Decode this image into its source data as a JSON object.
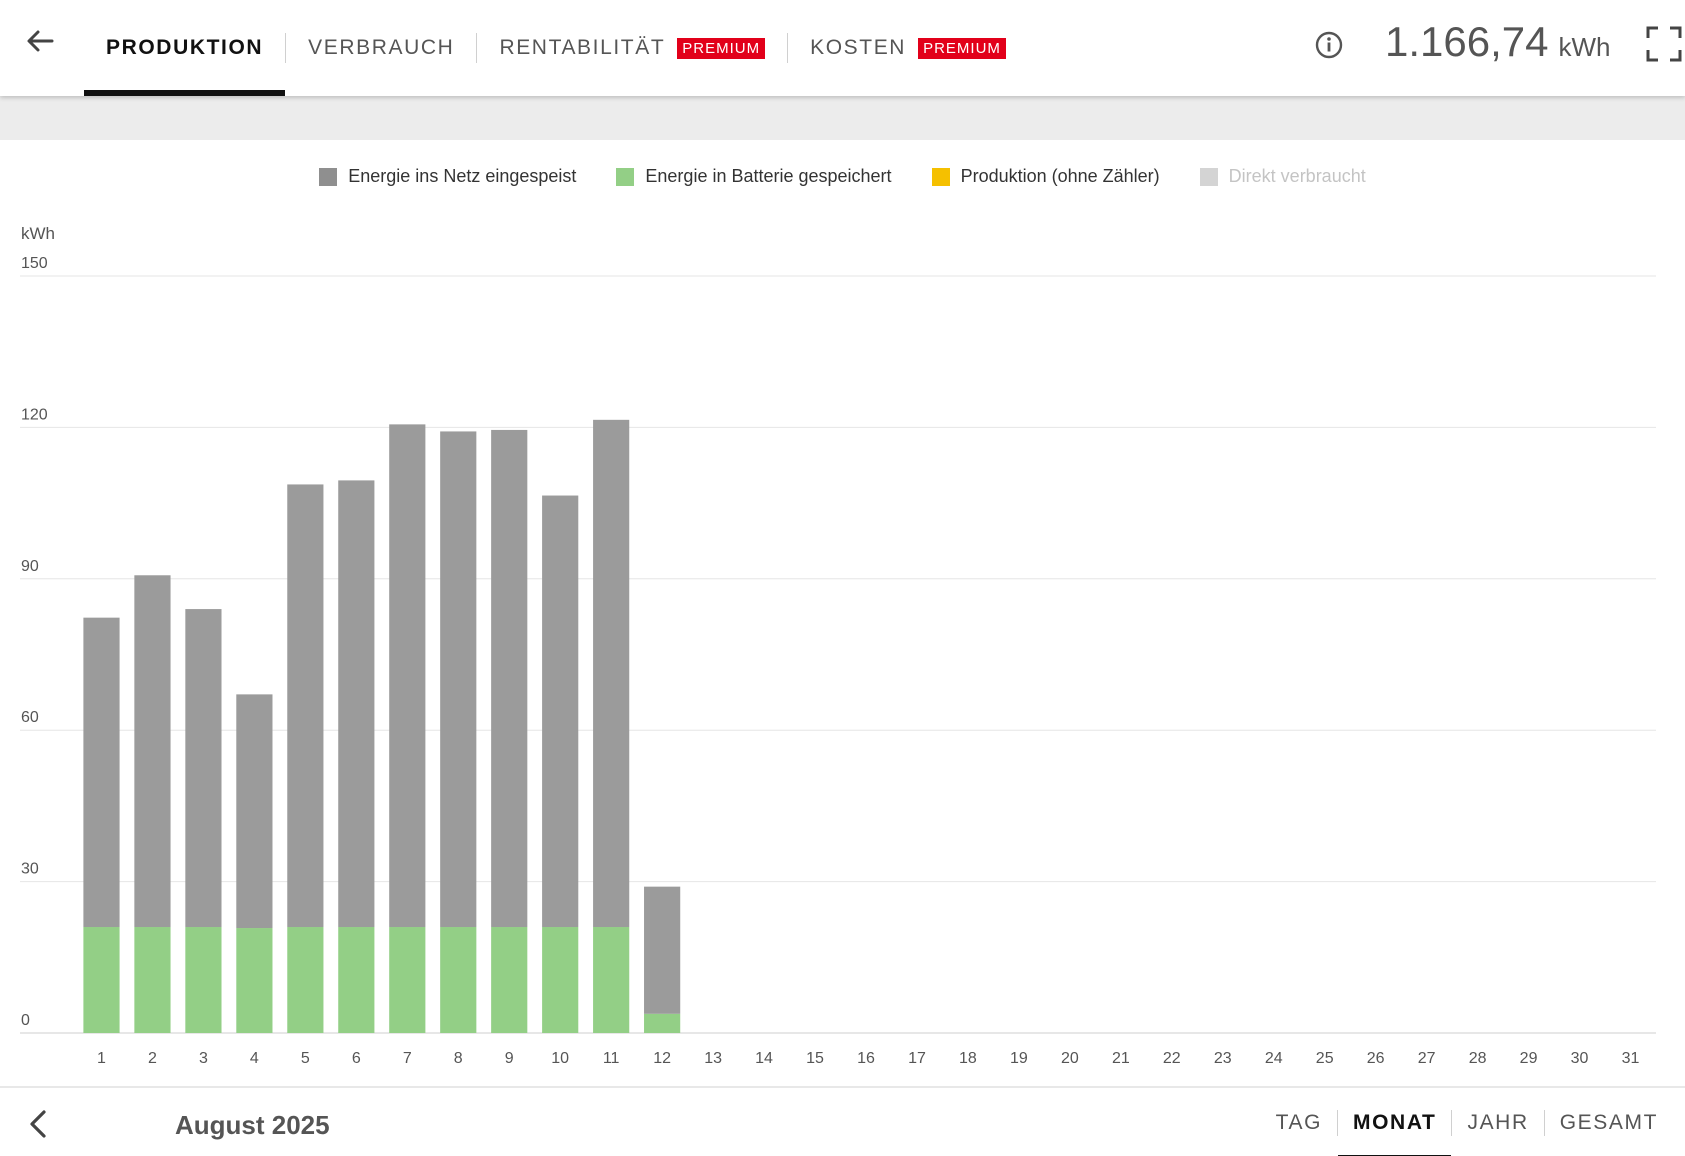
{
  "header": {
    "tabs": [
      {
        "label": "PRODUKTION",
        "active": true,
        "badge": ""
      },
      {
        "label": "VERBRAUCH",
        "active": false,
        "badge": ""
      },
      {
        "label": "RENTABILITÄT",
        "active": false,
        "badge": "PREMIUM"
      },
      {
        "label": "KOSTEN",
        "active": false,
        "badge": "PREMIUM"
      }
    ],
    "total_value": "1.166,74",
    "total_unit": "kWh"
  },
  "colors": {
    "grid_feed": "#9b9b9b",
    "battery": "#93cf86",
    "production_no_meter": "#f5c000",
    "direct_consumed": "#cccccc",
    "badge": "#e2001a"
  },
  "legend": [
    {
      "label": "Energie ins Netz eingespeist",
      "color": "#8f8f8f",
      "enabled": true
    },
    {
      "label": "Energie in Batterie gespeichert",
      "color": "#93cf86",
      "enabled": true
    },
    {
      "label": "Produktion (ohne Zähler)",
      "color": "#f5c000",
      "enabled": true
    },
    {
      "label": "Direkt verbraucht",
      "color": "#cccccc",
      "enabled": false
    }
  ],
  "chart_data": {
    "type": "bar",
    "stacked": true,
    "ylabel": "kWh",
    "ylim": [
      0,
      150
    ],
    "yticks": [
      0,
      30,
      60,
      90,
      120,
      150
    ],
    "grid": true,
    "legend_position": "top-center",
    "categories": [
      "1",
      "2",
      "3",
      "4",
      "5",
      "6",
      "7",
      "8",
      "9",
      "10",
      "11",
      "12",
      "13",
      "14",
      "15",
      "16",
      "17",
      "18",
      "19",
      "20",
      "21",
      "22",
      "23",
      "24",
      "25",
      "26",
      "27",
      "28",
      "29",
      "30",
      "31"
    ],
    "series": [
      {
        "name": "Energie in Batterie gespeichert",
        "color": "#93cf86",
        "values": [
          21,
          21,
          21,
          20.8,
          21,
          21,
          21,
          21,
          21,
          21,
          21,
          3.8,
          0,
          0,
          0,
          0,
          0,
          0,
          0,
          0,
          0,
          0,
          0,
          0,
          0,
          0,
          0,
          0,
          0,
          0,
          0
        ]
      },
      {
        "name": "Energie ins Netz eingespeist",
        "color": "#9b9b9b",
        "values": [
          61.3,
          69.7,
          63,
          46.3,
          87.7,
          88.5,
          99.6,
          98.2,
          98.5,
          85.5,
          100.5,
          25.2,
          0,
          0,
          0,
          0,
          0,
          0,
          0,
          0,
          0,
          0,
          0,
          0,
          0,
          0,
          0,
          0,
          0,
          0,
          0
        ]
      }
    ]
  },
  "footer": {
    "period_title": "August 2025",
    "period_tabs": [
      {
        "label": "TAG",
        "active": false
      },
      {
        "label": "MONAT",
        "active": true
      },
      {
        "label": "JAHR",
        "active": false
      },
      {
        "label": "GESAMT",
        "active": false
      }
    ]
  }
}
